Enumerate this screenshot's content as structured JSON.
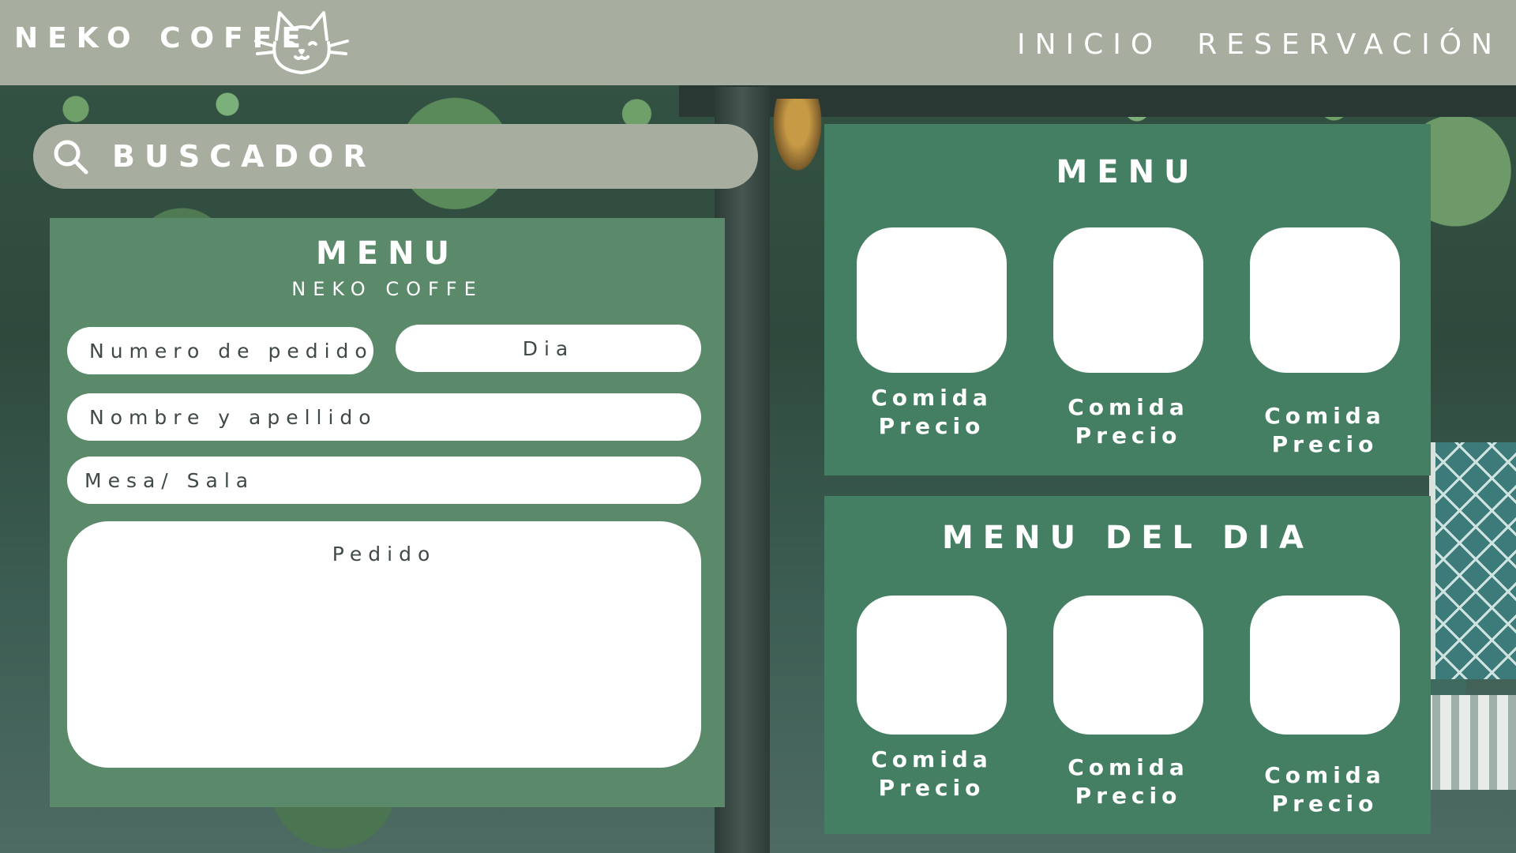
{
  "header": {
    "brand": "NEKO COFFE",
    "logo_icon": "cat-face-icon",
    "nav": [
      {
        "label": "INICIO"
      },
      {
        "label": "RESERVACIÓN"
      }
    ]
  },
  "search": {
    "placeholder": "BUSCADOR",
    "icon": "search-icon"
  },
  "order_form": {
    "title": "MENU",
    "subtitle": "NEKO COFFE",
    "fields": {
      "order_number": "Numero de pedido",
      "day": "Dia",
      "full_name": "Nombre y apellido",
      "table_room": "Mesa/ Sala",
      "order": "Pedido"
    }
  },
  "menu": {
    "title": "MENU",
    "items": [
      {
        "name": "Comida",
        "price": "Precio"
      },
      {
        "name": "Comida",
        "price": "Precio"
      },
      {
        "name": "Comida",
        "price": "Precio"
      }
    ]
  },
  "menu_del_dia": {
    "title": "MENU DEL DIA",
    "items": [
      {
        "name": "Comida",
        "price": "Precio"
      },
      {
        "name": "Comida",
        "price": "Precio"
      },
      {
        "name": "Comida",
        "price": "Precio"
      }
    ]
  },
  "colors": {
    "header_bg": "#a7ad9f",
    "order_panel_bg": "#5b8a6b",
    "menu_panel_bg": "#457f63",
    "text_light": "#ffffff"
  }
}
